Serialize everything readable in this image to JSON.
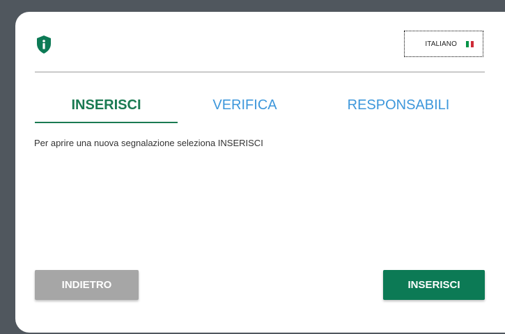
{
  "header": {
    "logo_icon": "shield-info-icon",
    "language": {
      "label": "ITALIANO",
      "flag_icon": "italy-flag-icon",
      "flag_colors": [
        "#009246",
        "#ffffff",
        "#ce2b37"
      ]
    }
  },
  "tabs": [
    {
      "label": "INSERISCI",
      "active": true
    },
    {
      "label": "VERIFICA",
      "active": false
    },
    {
      "label": "RESPONSABILI",
      "active": false
    }
  ],
  "main": {
    "instructions": "Per aprire una nuova segnalazione seleziona INSERISCI"
  },
  "actions": {
    "back_label": "INDIETRO",
    "insert_label": "INSERISCI"
  },
  "colors": {
    "brand": "#0c7a55",
    "link": "#3d97db",
    "disabled": "#a6a6a6",
    "backdrop": "#50575e"
  }
}
